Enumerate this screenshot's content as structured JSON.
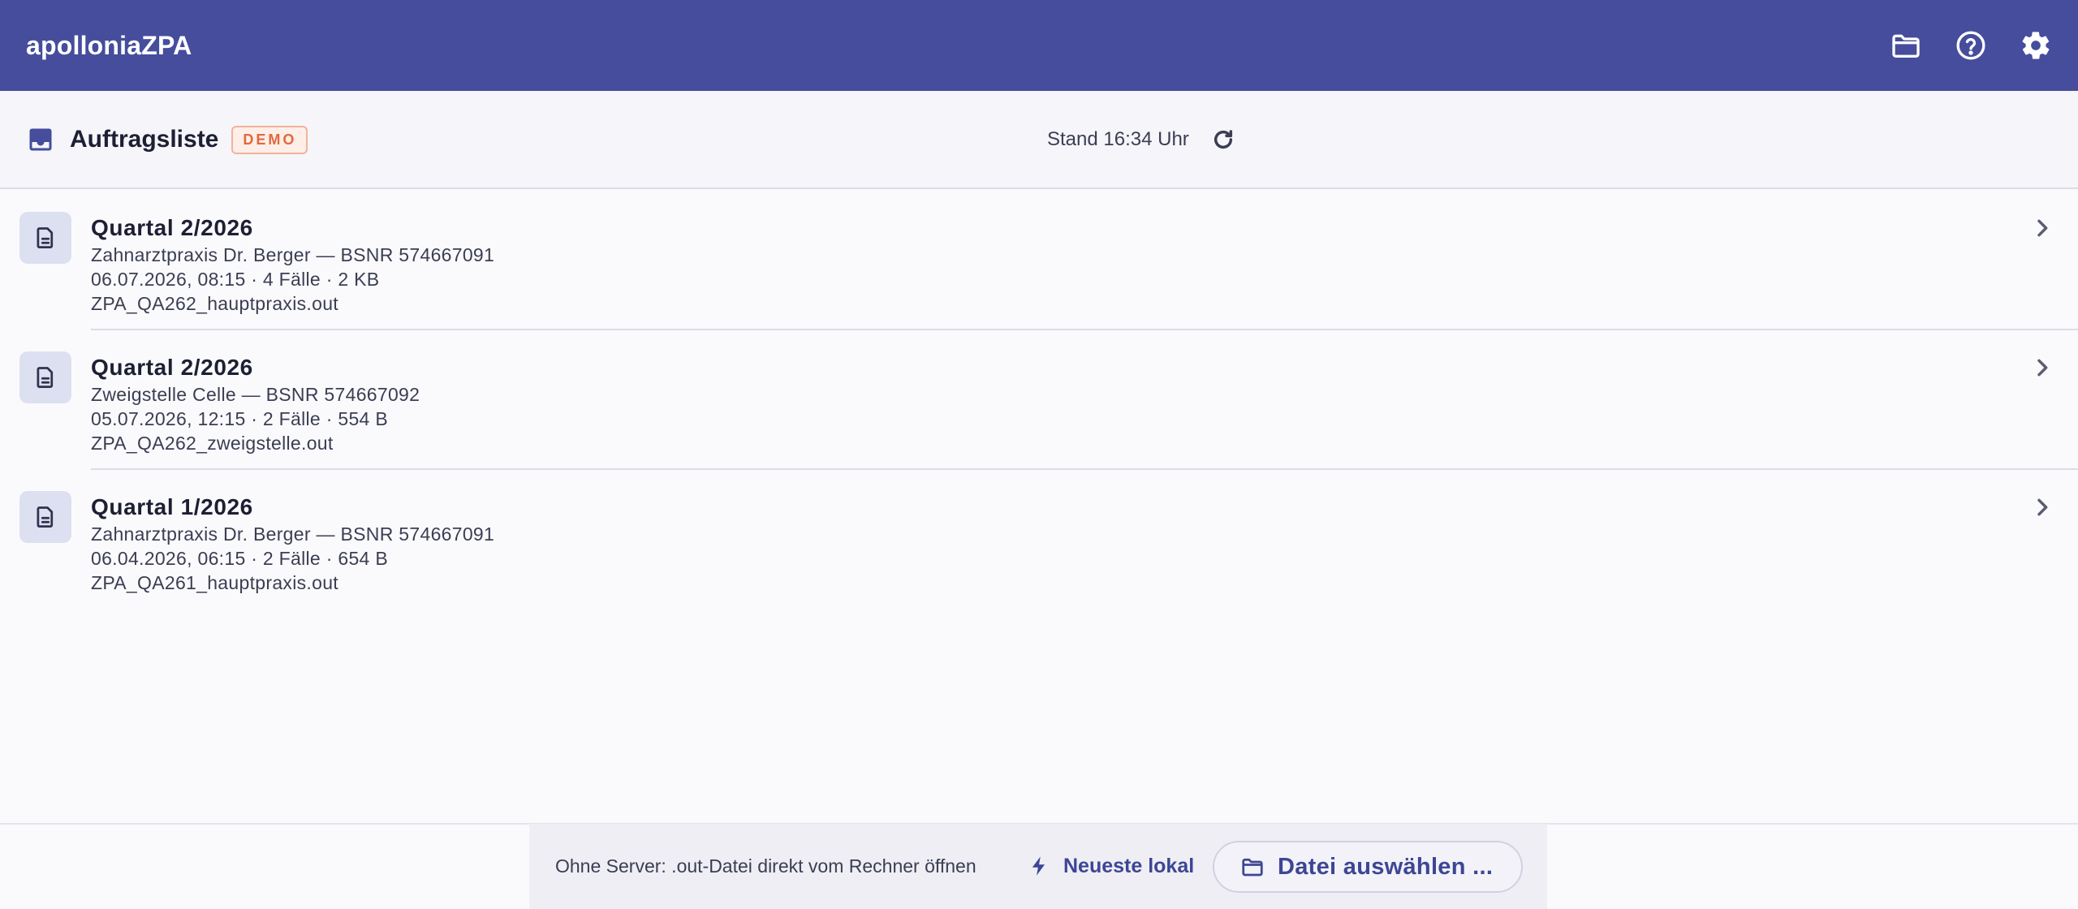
{
  "app": {
    "title": "apolloniaZPA"
  },
  "header_icons": {
    "folder": "folder-icon",
    "help": "help-icon",
    "settings": "gear-icon"
  },
  "toolbar": {
    "title": "Auftragsliste",
    "badge": "DEMO",
    "stand": "Stand 16:34 Uhr"
  },
  "items": [
    {
      "title": "Quartal 2/2026",
      "practice": "Zahnarztpraxis Dr. Berger — BSNR 574667091",
      "meta": "06.07.2026, 08:15  ·  4 Fälle  ·  2 KB",
      "file": "ZPA_QA262_hauptpraxis.out"
    },
    {
      "title": "Quartal 2/2026",
      "practice": "Zweigstelle Celle — BSNR 574667092",
      "meta": "05.07.2026, 12:15  ·  2 Fälle  ·  554 B",
      "file": "ZPA_QA262_zweigstelle.out"
    },
    {
      "title": "Quartal 1/2026",
      "practice": "Zahnarztpraxis Dr. Berger — BSNR 574667091",
      "meta": "06.04.2026, 06:15  ·  2 Fälle  ·  654 B",
      "file": "ZPA_QA261_hauptpraxis.out"
    }
  ],
  "footer": {
    "hint": "Ohne Server: .out-Datei direkt vom Rechner öffnen",
    "latest_label": "Neueste lokal",
    "file_label": "Datei auswählen ..."
  },
  "colors": {
    "appbar": "#454d9c",
    "accent": "#3d4694",
    "badge": "#e06a3c"
  }
}
